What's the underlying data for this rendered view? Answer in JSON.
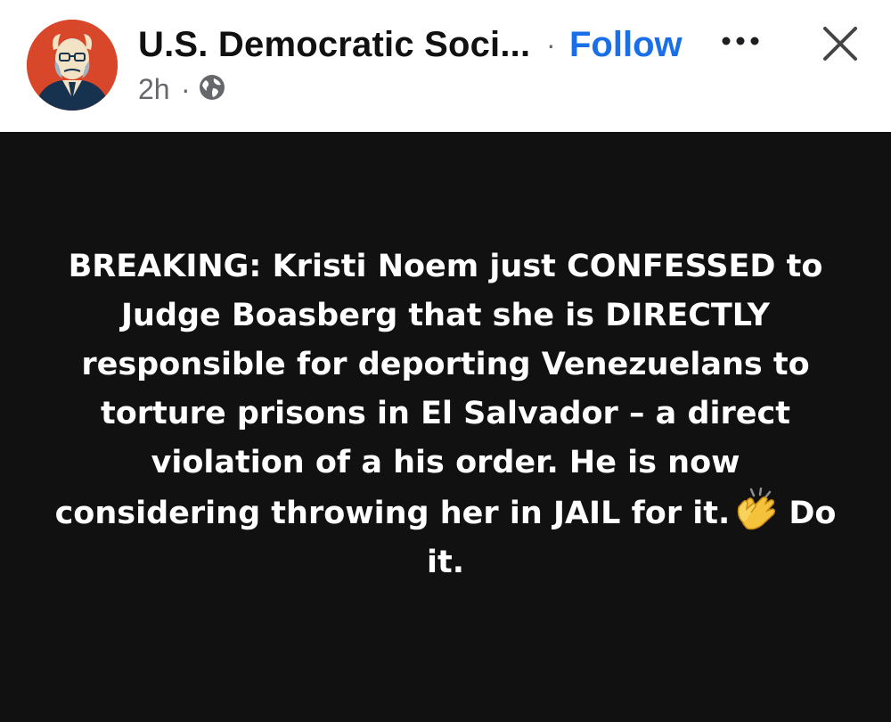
{
  "header": {
    "page_name": "U.S. Democratic Soci...",
    "separator": "·",
    "follow_label": "Follow",
    "time": "2h",
    "time_separator": "·",
    "visibility_icon": "globe-icon",
    "more_icon": "more-options-icon",
    "close_icon": "close-icon"
  },
  "post": {
    "background_color": "#111111",
    "text_color": "#ffffff",
    "text_before_emoji": "BREAKING: Kristi Noem just CONFESSED to Judge Boasberg that she is DIRECTLY responsible for deporting Venezuelans to torture prisons in El Salvador – a direct violation of a his order. He is now considering throwing her in JAIL for it.",
    "emoji": "clapping-hands-emoji",
    "text_after_emoji": "Do it."
  },
  "colors": {
    "accent": "#1a6fe8",
    "muted": "#65676b",
    "avatar_bg": "#d9472b"
  }
}
